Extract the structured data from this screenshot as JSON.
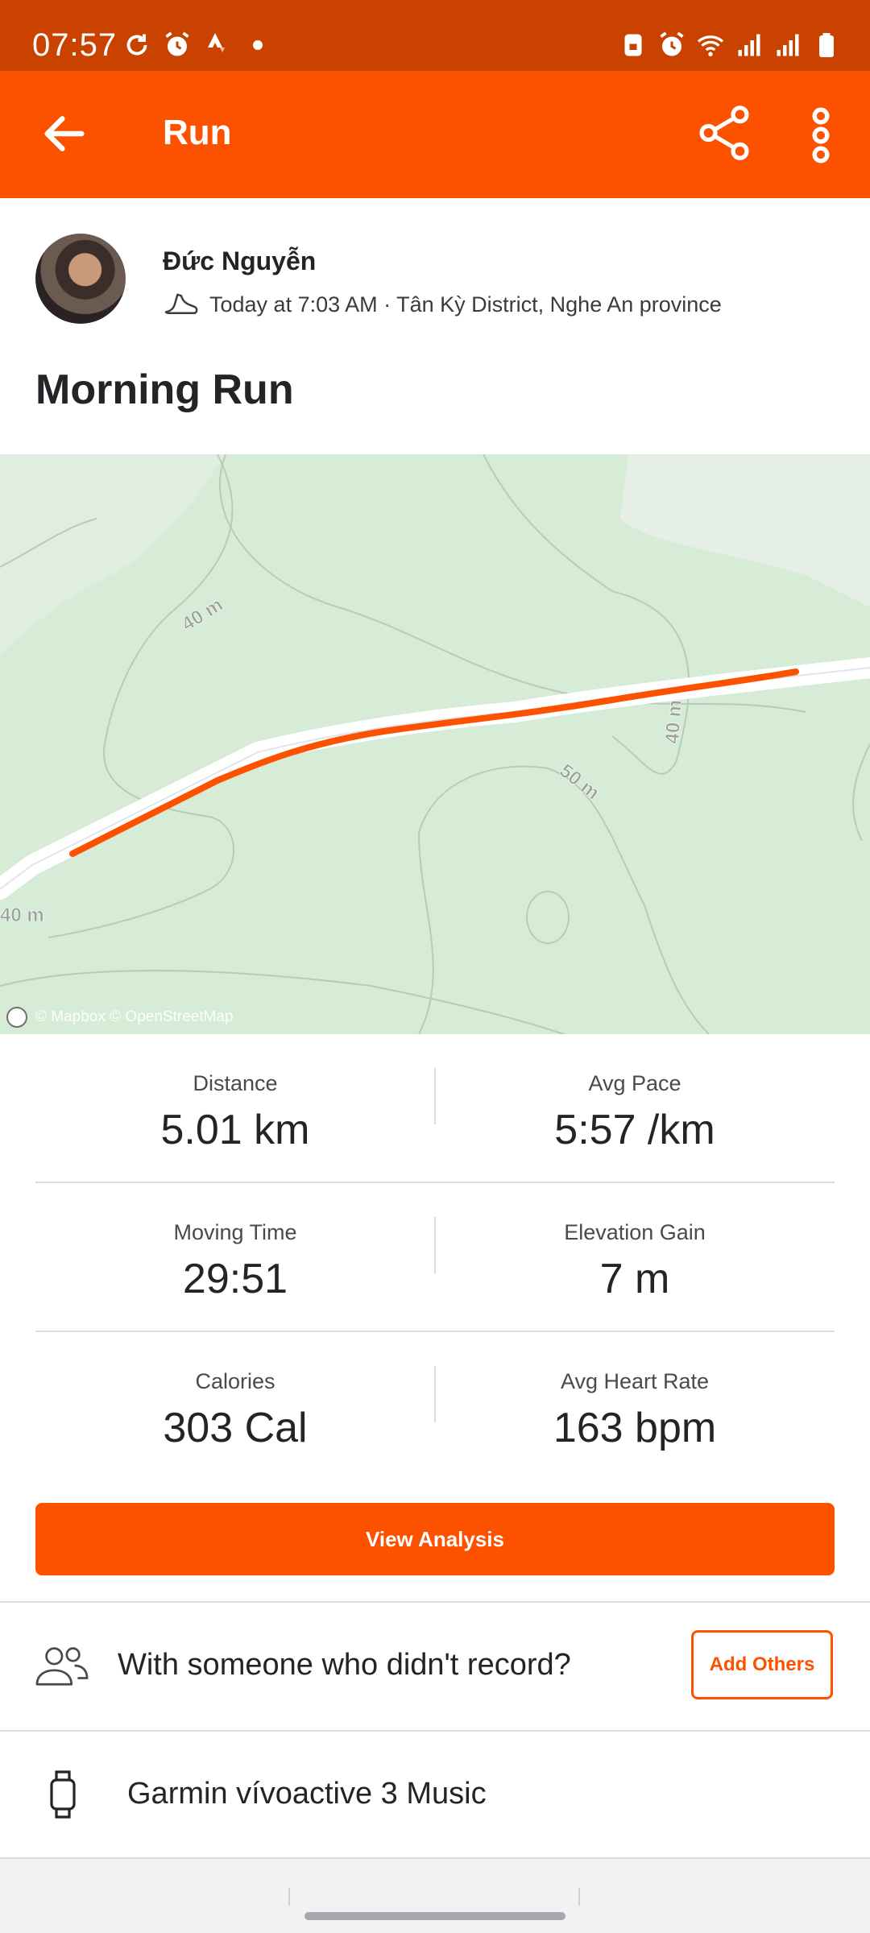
{
  "status_bar": {
    "time": "07:57",
    "left_icons": [
      "sync-icon",
      "alarm-icon",
      "strava-icon",
      "dot-icon"
    ],
    "right_icons": [
      "sim-lock-icon",
      "alarm-icon",
      "wifi-icon",
      "signal-icon",
      "signal-icon",
      "battery-icon"
    ]
  },
  "app_bar": {
    "title": "Run",
    "back_icon": "arrow-left-icon",
    "share_icon": "share-icon",
    "more_icon": "more-vertical-icon"
  },
  "activity": {
    "athlete_name": "Đức Nguyễn",
    "meta": "Today at 7:03 AM · Tân Kỳ District, Nghe An province",
    "title": "Morning Run"
  },
  "map": {
    "contour_labels": [
      "40 m",
      "40 m",
      "50 m",
      "40 m"
    ],
    "attribution": "© Mapbox © OpenStreetMap",
    "route_color": "#fc5200",
    "land_color": "#d6ecd6"
  },
  "stats": [
    {
      "left": {
        "label": "Distance",
        "value": "5.01 km"
      },
      "right": {
        "label": "Avg Pace",
        "value": "5:57 /km"
      }
    },
    {
      "left": {
        "label": "Moving Time",
        "value": "29:51"
      },
      "right": {
        "label": "Elevation Gain",
        "value": "7 m"
      }
    },
    {
      "left": {
        "label": "Calories",
        "value": "303 Cal"
      },
      "right": {
        "label": "Avg Heart Rate",
        "value": "163 bpm"
      }
    }
  ],
  "view_analysis_label": "View Analysis",
  "with_others": {
    "text": "With someone who didn't record?",
    "button_label": "Add Others"
  },
  "device": {
    "name": "Garmin vívoactive 3 Music"
  },
  "colors": {
    "accent": "#fc5200",
    "status_bar": "#c94200"
  }
}
